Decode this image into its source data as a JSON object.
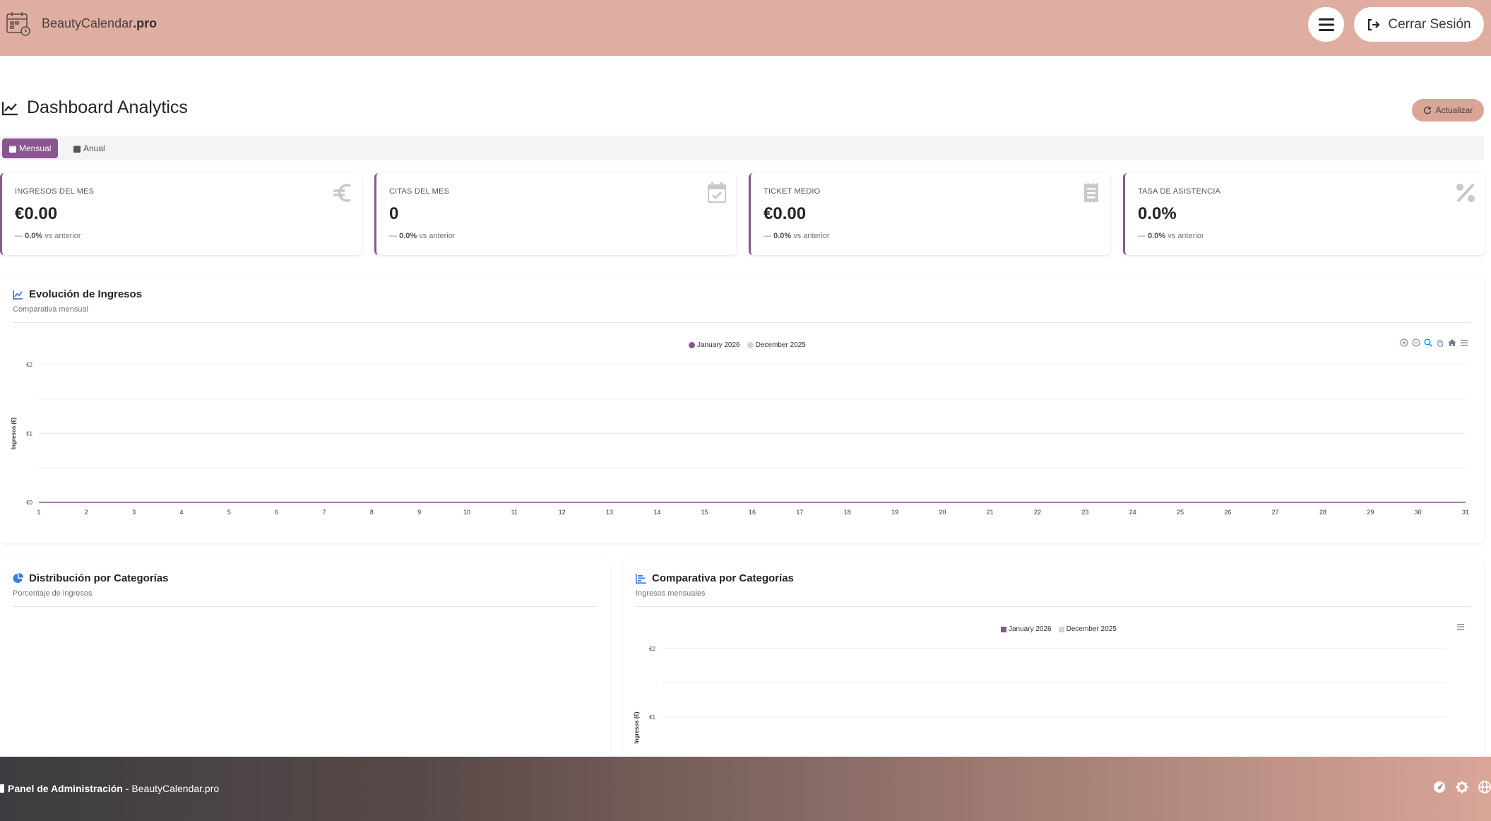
{
  "header": {
    "brand_name": "BeautyCalendar",
    "brand_suffix": ".pro",
    "logout_label": "Cerrar Sesión"
  },
  "page": {
    "title": "Dashboard Analytics",
    "refresh_label": "Actualizar"
  },
  "tabs": [
    {
      "label": "Mensual",
      "active": true
    },
    {
      "label": "Anual",
      "active": false
    }
  ],
  "kpis": [
    {
      "label": "INGRESOS DEL MES",
      "value": "€0.00",
      "change": "0.0%",
      "change_suffix": "vs anterior",
      "icon": "euro-icon"
    },
    {
      "label": "CITAS DEL MES",
      "value": "0",
      "change": "0.0%",
      "change_suffix": "vs anterior",
      "icon": "calendar-check-icon"
    },
    {
      "label": "TICKET MEDIO",
      "value": "€0.00",
      "change": "0.0%",
      "change_suffix": "vs anterior",
      "icon": "receipt-icon"
    },
    {
      "label": "TASA DE ASISTENCIA",
      "value": "0.0%",
      "change": "0.0%",
      "change_suffix": "vs anterior",
      "icon": "percent-icon"
    }
  ],
  "revenue_panel": {
    "title": "Evolución de Ingresos",
    "subtitle": "Comparativa mensual"
  },
  "distribution_panel": {
    "title": "Distribución por Categorías",
    "subtitle": "Porcentaje de ingresos"
  },
  "comparison_panel": {
    "title": "Comparativa por Categorías",
    "subtitle": "Ingresos mensuales"
  },
  "footer": {
    "title": "Panel de Administración",
    "suffix": "- BeautyCalendar.pro"
  },
  "colors": {
    "header_bg": "#dfaea0",
    "accent": "#8a5690",
    "series_current": "#8a5690",
    "series_previous": "#d3d3d3"
  },
  "chart_data": [
    {
      "type": "line",
      "ylabel": "Ingresos (€)",
      "xlabel": "",
      "x": [
        1,
        2,
        3,
        4,
        5,
        6,
        7,
        8,
        9,
        10,
        11,
        12,
        13,
        14,
        15,
        16,
        17,
        18,
        19,
        20,
        21,
        22,
        23,
        24,
        25,
        26,
        27,
        28,
        29,
        30,
        31
      ],
      "y_ticks": [
        "€0",
        "€1",
        "€2"
      ],
      "ylim": [
        0,
        2
      ],
      "series": [
        {
          "name": "January 2026",
          "values": [
            0,
            0,
            0,
            0,
            0,
            0,
            0,
            0,
            0,
            0,
            0,
            0,
            0,
            0,
            0,
            0,
            0,
            0,
            0,
            0,
            0,
            0,
            0,
            0,
            0,
            0,
            0,
            0,
            0,
            0,
            0
          ]
        },
        {
          "name": "December 2025",
          "values": [
            0,
            0,
            0,
            0,
            0,
            0,
            0,
            0,
            0,
            0,
            0,
            0,
            0,
            0,
            0,
            0,
            0,
            0,
            0,
            0,
            0,
            0,
            0,
            0,
            0,
            0,
            0,
            0,
            0,
            0,
            0
          ]
        }
      ],
      "legend": "top-center",
      "grid": true
    },
    {
      "type": "bar",
      "ylabel": "Ingresos (€)",
      "y_ticks": [
        "€1",
        "€2"
      ],
      "ylim": [
        0,
        2
      ],
      "categories": [],
      "series": [
        {
          "name": "January 2026",
          "values": []
        },
        {
          "name": "December 2025",
          "values": []
        }
      ],
      "legend": "top-center",
      "grid": true
    }
  ]
}
